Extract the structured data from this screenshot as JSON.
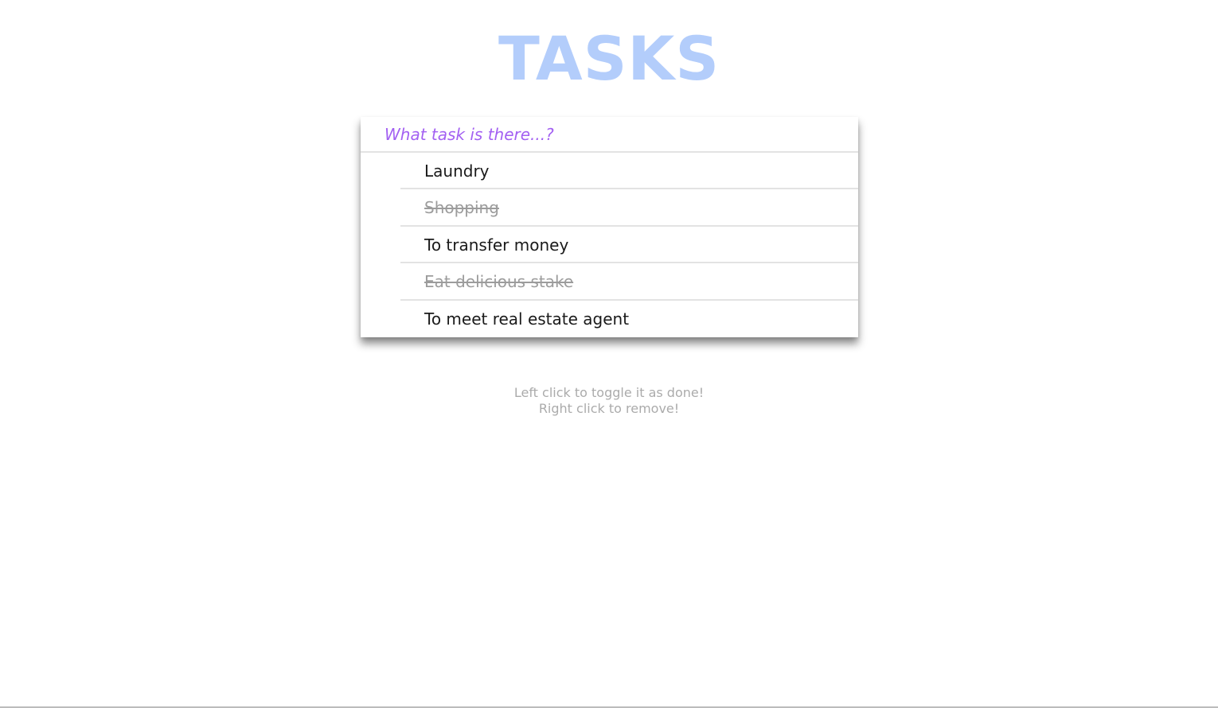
{
  "header": {
    "title": "TASKS"
  },
  "task_input": {
    "placeholder": "What task is there...?",
    "value": ""
  },
  "tasks": [
    {
      "label": "Laundry",
      "done": false
    },
    {
      "label": "Shopping",
      "done": true
    },
    {
      "label": "To transfer money",
      "done": false
    },
    {
      "label": "Eat delicious stake",
      "done": true
    },
    {
      "label": "To meet real estate agent",
      "done": false
    }
  ],
  "hints": {
    "line1": "Left click to toggle it as done!",
    "line2": "Right click to remove!"
  },
  "colors": {
    "title": "#b3cdfb",
    "placeholder": "#a361f2",
    "done_text": "#9c9c9c",
    "hint_text": "#ababab"
  }
}
